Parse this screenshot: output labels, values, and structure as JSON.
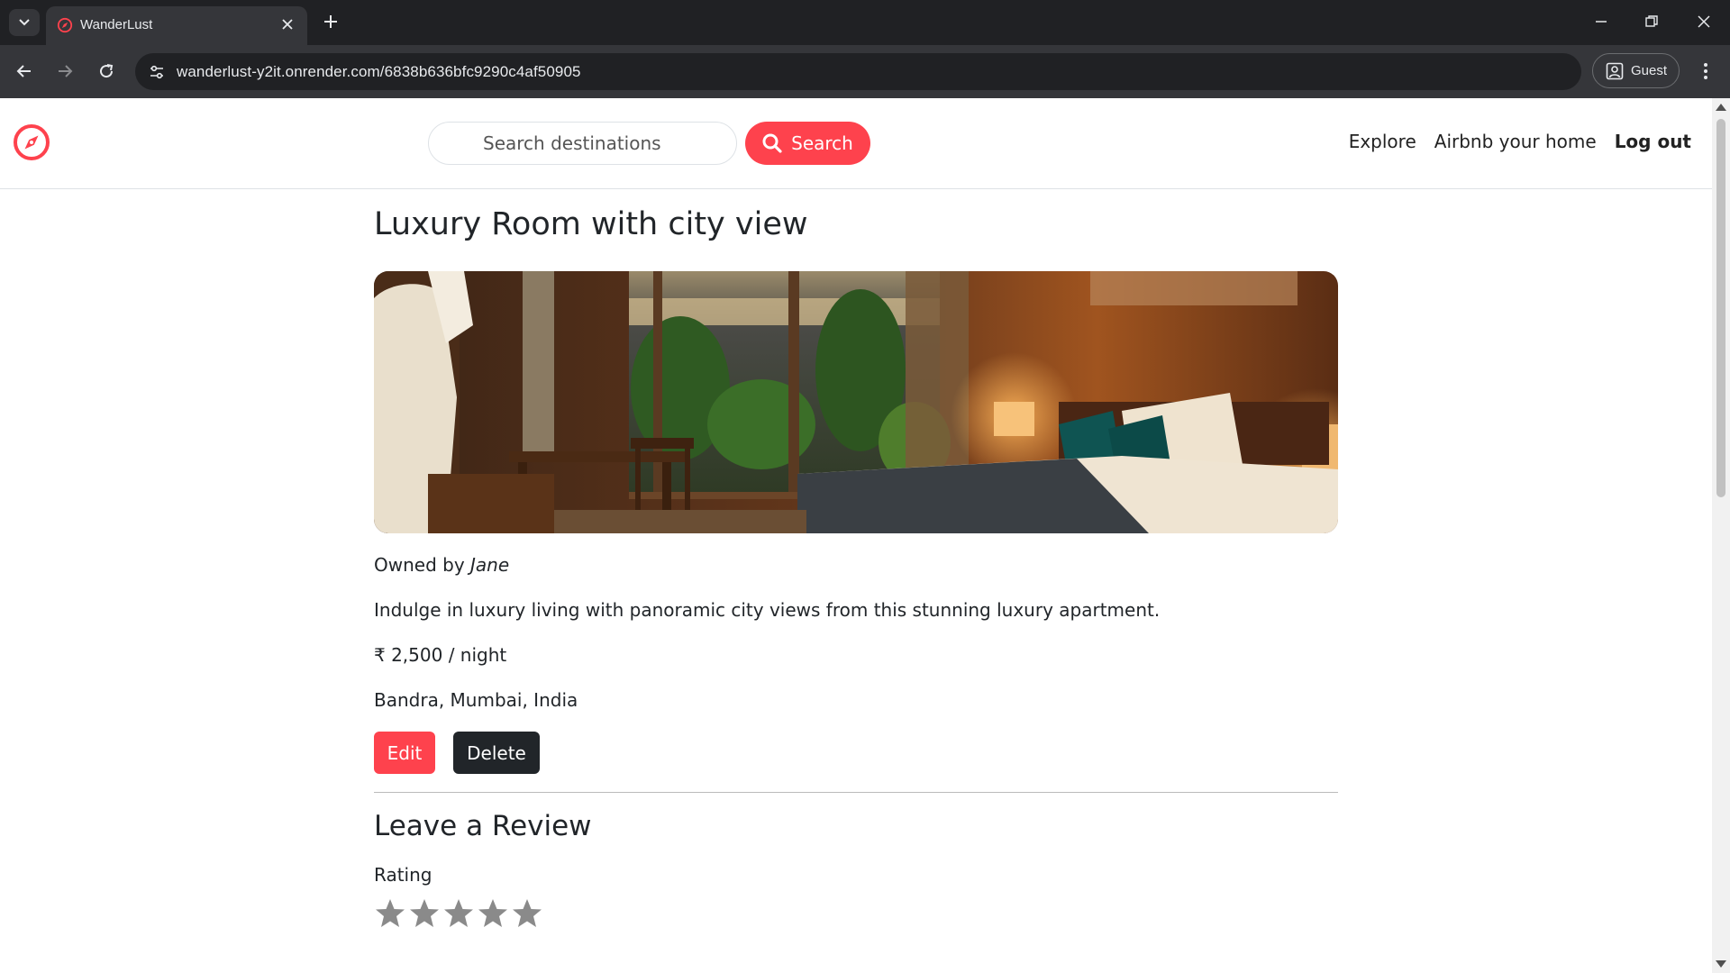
{
  "browser": {
    "tab_title": "WanderLust",
    "url": "wanderlust-y2it.onrender.com/6838b636bfc9290c4af50905",
    "profile_label": "Guest"
  },
  "nav": {
    "search_placeholder": "Search destinations",
    "search_button": "Search",
    "links": [
      "Explore",
      "Airbnb your home",
      "Log out"
    ]
  },
  "listing": {
    "title": "Luxury Room with city view",
    "owned_by_prefix": "Owned by ",
    "owner": "Jane",
    "description": "Indulge in luxury living with panoramic city views from this stunning luxury apartment.",
    "price": "₹ 2,500 / night",
    "location": "Bandra, Mumbai, India",
    "edit_label": "Edit",
    "delete_label": "Delete"
  },
  "review": {
    "heading": "Leave a Review",
    "rating_label": "Rating",
    "star_count": 5
  },
  "colors": {
    "brand": "#fe424d",
    "dark_button": "#212529",
    "chrome_dark": "#202124",
    "chrome_toolbar": "#35363a"
  },
  "icons": {
    "brand": "compass-icon",
    "search": "search-icon",
    "star": "star-icon"
  }
}
